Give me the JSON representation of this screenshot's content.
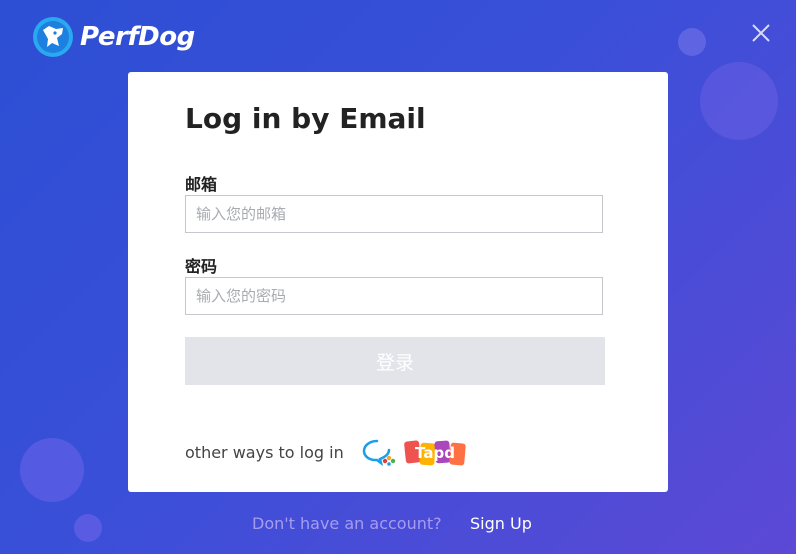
{
  "brand": {
    "name": "PerfDog",
    "logo_icon": "dog-head-logo-icon"
  },
  "window": {
    "close_icon": "close-icon"
  },
  "form": {
    "title": "Log in by Email",
    "email_label": "邮箱",
    "email_placeholder": "输入您的邮箱",
    "email_value": "",
    "password_label": "密码",
    "password_placeholder": "输入您的密码",
    "password_value": "",
    "submit_label": "登录"
  },
  "alt_login": {
    "label": "other ways to log in",
    "methods": [
      {
        "name": "wechat-work",
        "icon": "wechat-work-icon"
      },
      {
        "name": "tapd",
        "icon": "tapd-icon",
        "text": "Tapd"
      }
    ]
  },
  "footer": {
    "question": "Don't have an account?",
    "signup_label": "Sign Up"
  },
  "colors": {
    "background_start": "#2c4fd4",
    "background_end": "#5c49d6",
    "card": "#ffffff",
    "button_disabled": "#e2e4ea",
    "footer_question": "#a69cef"
  }
}
